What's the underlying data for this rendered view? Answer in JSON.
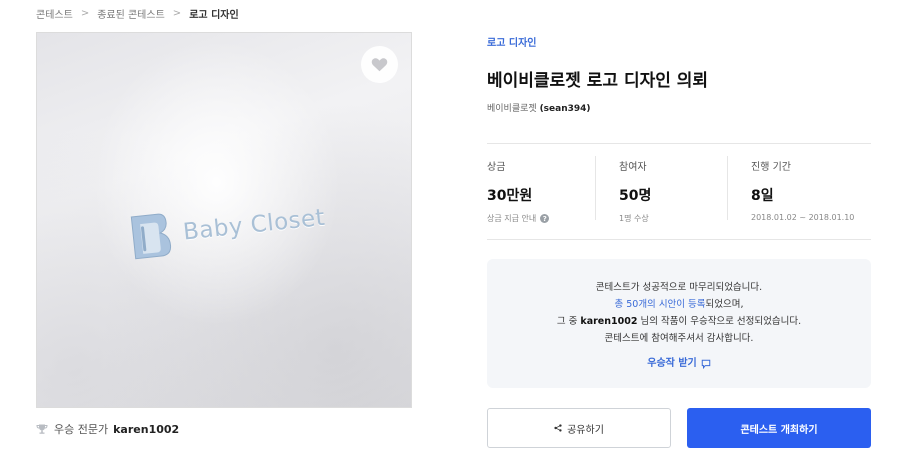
{
  "breadcrumb": {
    "items": [
      "콘테스트",
      "종료된 콘테스트",
      "로고 디자인"
    ],
    "separator": ">"
  },
  "contest": {
    "category": "로고 디자인",
    "title": "베이비클로젯 로고 디자인 의뢰",
    "owner_name": "베이비클로젯",
    "owner_id": "(sean394)",
    "image_logo_text": "Baby Closet"
  },
  "stats": [
    {
      "label": "상금",
      "value": "30만원",
      "sub": "상금 지급 안내",
      "sub_icon": "question-icon"
    },
    {
      "label": "참여자",
      "value": "50명",
      "sub": "1명 수상"
    },
    {
      "label": "진행 기간",
      "value": "8일",
      "sub": "2018.01.02 ~ 2018.01.10"
    }
  ],
  "notice": {
    "line1": "콘테스트가 성공적으로 마무리되었습니다.",
    "line2_link": "총 50개의 시안이 등록",
    "line2_rest": "되었으며,",
    "line3_pre": "그 중 ",
    "line3_name": "karen1002",
    "line3_post": " 님의 작품이 우승작으로 선정되었습니다.",
    "line4": "콘테스트에 참여해주셔서 감사합니다.",
    "cta": "우승작 받기"
  },
  "winner": {
    "label": "우승 전문가",
    "name": "karen1002"
  },
  "buttons": {
    "share": "공유하기",
    "host": "콘테스트 개최하기"
  },
  "colors": {
    "accent": "#3a6bd8",
    "primary_button": "#2b5ff0",
    "notice_bg": "#f4f6f9"
  }
}
